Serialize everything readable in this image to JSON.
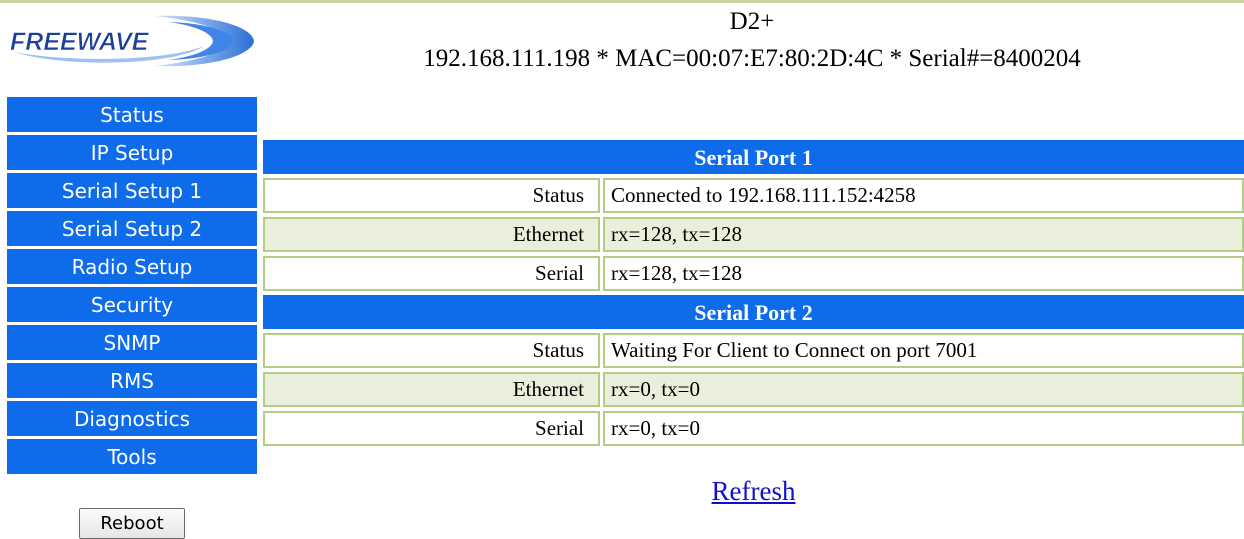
{
  "header": {
    "title": "D2+",
    "subtitle": "192.168.111.198 * MAC=00:07:E7:80:2D:4C * Serial#=8400204"
  },
  "logo": {
    "text": "FREEWAVE",
    "icon": "freewave-logo"
  },
  "nav": {
    "items": [
      {
        "label": "Status"
      },
      {
        "label": "IP Setup"
      },
      {
        "label": "Serial Setup 1"
      },
      {
        "label": "Serial Setup 2"
      },
      {
        "label": "Radio Setup"
      },
      {
        "label": "Security"
      },
      {
        "label": "SNMP"
      },
      {
        "label": "RMS"
      },
      {
        "label": "Diagnostics"
      },
      {
        "label": "Tools"
      }
    ],
    "reboot_label": "Reboot"
  },
  "ports": [
    {
      "title": "Serial Port 1",
      "rows": [
        {
          "label": "Status",
          "value": "Connected to 192.168.111.152:4258"
        },
        {
          "label": "Ethernet",
          "value": "rx=128,  tx=128"
        },
        {
          "label": "Serial",
          "value": "rx=128,  tx=128"
        }
      ]
    },
    {
      "title": "Serial Port 2",
      "rows": [
        {
          "label": "Status",
          "value": "Waiting For Client to Connect on port 7001"
        },
        {
          "label": "Ethernet",
          "value": "rx=0,  tx=0"
        },
        {
          "label": "Serial",
          "value": "rx=0,  tx=0"
        }
      ]
    }
  ],
  "refresh_label": "Refresh",
  "colors": {
    "nav_bg": "#0e6bea",
    "row_alt": "#e9efda",
    "cell_border": "#b3cd87",
    "link": "#1010cc"
  }
}
